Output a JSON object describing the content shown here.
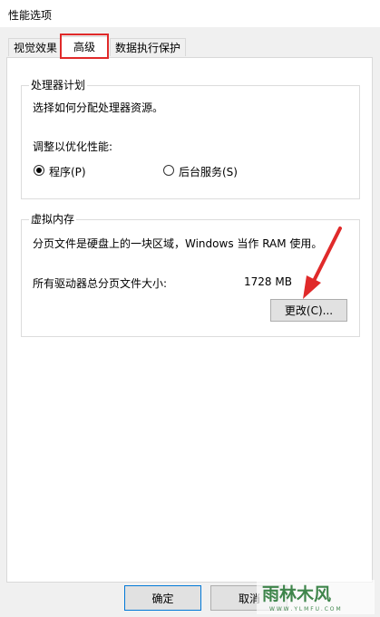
{
  "window": {
    "title": "性能选项"
  },
  "tabs": [
    {
      "label": "视觉效果"
    },
    {
      "label": "高级"
    },
    {
      "label": "数据执行保护"
    }
  ],
  "processor_group": {
    "title": "处理器计划",
    "description": "选择如何分配处理器资源。",
    "adjust_label": "调整以优化性能:",
    "options": [
      {
        "label": "程序(P)",
        "checked": true
      },
      {
        "label": "后台服务(S)",
        "checked": false
      }
    ]
  },
  "virtual_memory_group": {
    "title": "虚拟内存",
    "description": "分页文件是硬盘上的一块区域，Windows 当作 RAM 使用。",
    "total_label": "所有驱动器总分页文件大小:",
    "total_value": "1728 MB",
    "change_button": "更改(C)..."
  },
  "footer": {
    "ok_button": "确定",
    "cancel_button": "取消"
  },
  "watermark": {
    "text": "雨林木风",
    "url_text": "W W W . Y L M F U . C O M"
  },
  "colors": {
    "highlight_border": "#e02a2a",
    "annotation_arrow": "#e02a2a",
    "panel_background": "#ffffff",
    "dialog_background": "#f0f0f0"
  }
}
